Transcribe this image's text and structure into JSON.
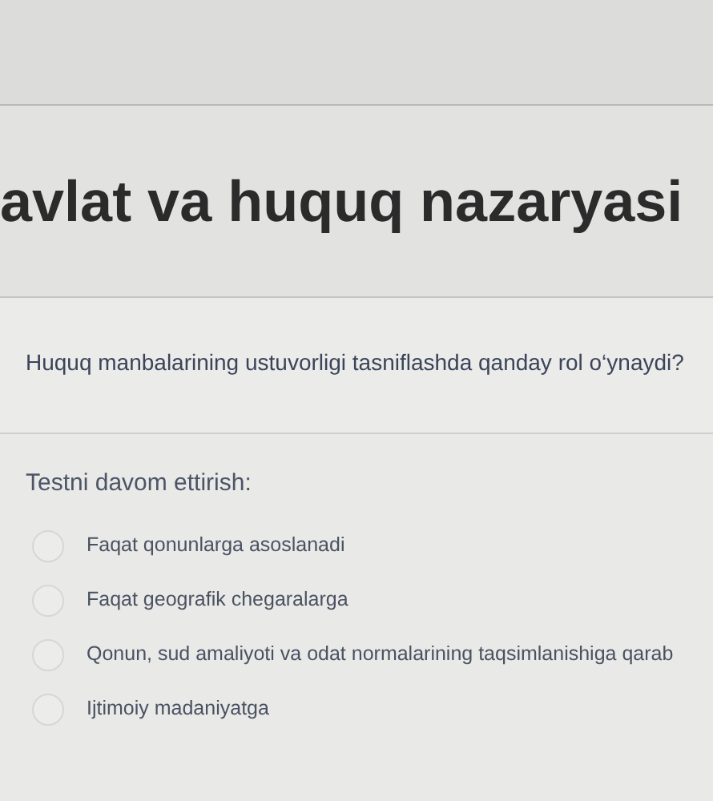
{
  "title": "avlat va huquq nazaryasi",
  "question": "Huquq manbalarining ustuvorligi tasniflashda qanday rol o‘ynaydi?",
  "prompt": "Testni davom ettirish:",
  "options": [
    {
      "label": "Faqat qonunlarga asoslanadi",
      "selected": false
    },
    {
      "label": "Faqat geografik chegaralarga",
      "selected": false
    },
    {
      "label": "Qonun, sud amaliyoti va odat normalarining taqsimlanishiga qarab",
      "selected": false
    },
    {
      "label": "Ijtimoiy madaniyatga",
      "selected": false
    }
  ]
}
